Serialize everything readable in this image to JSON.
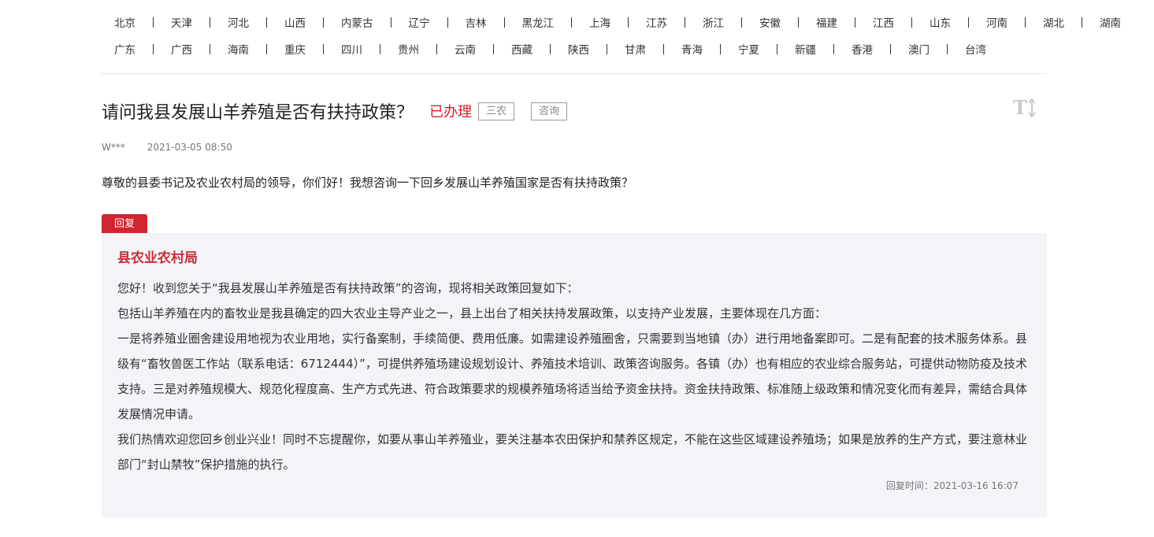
{
  "provinces_row1": [
    "北京",
    "天津",
    "河北",
    "山西",
    "内蒙古",
    "辽宁",
    "吉林",
    "黑龙江",
    "上海",
    "江苏",
    "浙江",
    "安徽",
    "福建",
    "江西",
    "山东",
    "河南",
    "湖北",
    "湖南"
  ],
  "provinces_row2": [
    "广东",
    "广西",
    "海南",
    "重庆",
    "四川",
    "贵州",
    "云南",
    "西藏",
    "陕西",
    "甘肃",
    "青海",
    "宁夏",
    "新疆",
    "香港",
    "澳门",
    "台湾"
  ],
  "question": {
    "title": "请问我县发展山羊养殖是否有扶持政策？",
    "status": "已办理",
    "tags": [
      "三农",
      "咨询"
    ],
    "author": "W***",
    "date": "2021-03-05 08:50",
    "body": "尊敬的县委书记及农业农村局的领导，你们好！我想咨询一下回乡发展山羊养殖国家是否有扶持政策？"
  },
  "reply": {
    "tab_label": "回复",
    "department": "县农业农村局",
    "paragraphs": [
      "您好！收到您关于“我县发展山羊养殖是否有扶持政策”的咨询，现将相关政策回复如下：",
      "包括山羊养殖在内的畜牧业是我县确定的四大农业主导产业之一，县上出台了相关扶持发展政策，以支持产业发展，主要体现在几方面：",
      "一是将养殖业圈舍建设用地视为农业用地，实行备案制，手续简便、费用低廉。如需建设养殖圈舍，只需要到当地镇（办）进行用地备案即可。二是有配套的技术服务体系。县级有“畜牧兽医工作站（联系电话：6712444）”，可提供养殖场建设规划设计、养殖技术培训、政策咨询服务。各镇（办）也有相应的农业综合服务站，可提供动物防疫及技术支持。三是对养殖规模大、规范化程度高、生产方式先进、符合政策要求的规模养殖场将适当给予资金扶持。资金扶持政策、标准随上级政策和情况变化而有差异，需结合具体发展情况申请。",
      "我们热情欢迎您回乡创业兴业！同时不忘提醒你，如要从事山羊养殖业，要关注基本农田保护和禁养区规定，不能在这些区域建设养殖场；如果是放养的生产方式，要注意林业部门“封山禁牧”保护措施的执行。"
    ],
    "time_label": "回复时间：",
    "time": "2021-03-16 16:07"
  },
  "colors": {
    "accent": "#d0242f",
    "dept": "#c82e38",
    "reply_bg": "#f3f4f8"
  },
  "icons": {
    "font_size": "text-size-icon"
  }
}
